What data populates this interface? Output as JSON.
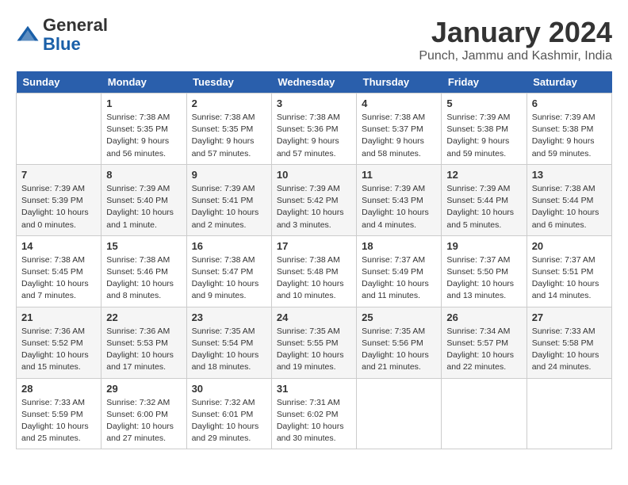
{
  "header": {
    "logo_general": "General",
    "logo_blue": "Blue",
    "month_title": "January 2024",
    "location": "Punch, Jammu and Kashmir, India"
  },
  "weekdays": [
    "Sunday",
    "Monday",
    "Tuesday",
    "Wednesday",
    "Thursday",
    "Friday",
    "Saturday"
  ],
  "weeks": [
    [
      {
        "day": "",
        "sunrise": "",
        "sunset": "",
        "daylight": ""
      },
      {
        "day": "1",
        "sunrise": "Sunrise: 7:38 AM",
        "sunset": "Sunset: 5:35 PM",
        "daylight": "Daylight: 9 hours and 56 minutes."
      },
      {
        "day": "2",
        "sunrise": "Sunrise: 7:38 AM",
        "sunset": "Sunset: 5:35 PM",
        "daylight": "Daylight: 9 hours and 57 minutes."
      },
      {
        "day": "3",
        "sunrise": "Sunrise: 7:38 AM",
        "sunset": "Sunset: 5:36 PM",
        "daylight": "Daylight: 9 hours and 57 minutes."
      },
      {
        "day": "4",
        "sunrise": "Sunrise: 7:38 AM",
        "sunset": "Sunset: 5:37 PM",
        "daylight": "Daylight: 9 hours and 58 minutes."
      },
      {
        "day": "5",
        "sunrise": "Sunrise: 7:39 AM",
        "sunset": "Sunset: 5:38 PM",
        "daylight": "Daylight: 9 hours and 59 minutes."
      },
      {
        "day": "6",
        "sunrise": "Sunrise: 7:39 AM",
        "sunset": "Sunset: 5:38 PM",
        "daylight": "Daylight: 9 hours and 59 minutes."
      }
    ],
    [
      {
        "day": "7",
        "sunrise": "Sunrise: 7:39 AM",
        "sunset": "Sunset: 5:39 PM",
        "daylight": "Daylight: 10 hours and 0 minutes."
      },
      {
        "day": "8",
        "sunrise": "Sunrise: 7:39 AM",
        "sunset": "Sunset: 5:40 PM",
        "daylight": "Daylight: 10 hours and 1 minute."
      },
      {
        "day": "9",
        "sunrise": "Sunrise: 7:39 AM",
        "sunset": "Sunset: 5:41 PM",
        "daylight": "Daylight: 10 hours and 2 minutes."
      },
      {
        "day": "10",
        "sunrise": "Sunrise: 7:39 AM",
        "sunset": "Sunset: 5:42 PM",
        "daylight": "Daylight: 10 hours and 3 minutes."
      },
      {
        "day": "11",
        "sunrise": "Sunrise: 7:39 AM",
        "sunset": "Sunset: 5:43 PM",
        "daylight": "Daylight: 10 hours and 4 minutes."
      },
      {
        "day": "12",
        "sunrise": "Sunrise: 7:39 AM",
        "sunset": "Sunset: 5:44 PM",
        "daylight": "Daylight: 10 hours and 5 minutes."
      },
      {
        "day": "13",
        "sunrise": "Sunrise: 7:38 AM",
        "sunset": "Sunset: 5:44 PM",
        "daylight": "Daylight: 10 hours and 6 minutes."
      }
    ],
    [
      {
        "day": "14",
        "sunrise": "Sunrise: 7:38 AM",
        "sunset": "Sunset: 5:45 PM",
        "daylight": "Daylight: 10 hours and 7 minutes."
      },
      {
        "day": "15",
        "sunrise": "Sunrise: 7:38 AM",
        "sunset": "Sunset: 5:46 PM",
        "daylight": "Daylight: 10 hours and 8 minutes."
      },
      {
        "day": "16",
        "sunrise": "Sunrise: 7:38 AM",
        "sunset": "Sunset: 5:47 PM",
        "daylight": "Daylight: 10 hours and 9 minutes."
      },
      {
        "day": "17",
        "sunrise": "Sunrise: 7:38 AM",
        "sunset": "Sunset: 5:48 PM",
        "daylight": "Daylight: 10 hours and 10 minutes."
      },
      {
        "day": "18",
        "sunrise": "Sunrise: 7:37 AM",
        "sunset": "Sunset: 5:49 PM",
        "daylight": "Daylight: 10 hours and 11 minutes."
      },
      {
        "day": "19",
        "sunrise": "Sunrise: 7:37 AM",
        "sunset": "Sunset: 5:50 PM",
        "daylight": "Daylight: 10 hours and 13 minutes."
      },
      {
        "day": "20",
        "sunrise": "Sunrise: 7:37 AM",
        "sunset": "Sunset: 5:51 PM",
        "daylight": "Daylight: 10 hours and 14 minutes."
      }
    ],
    [
      {
        "day": "21",
        "sunrise": "Sunrise: 7:36 AM",
        "sunset": "Sunset: 5:52 PM",
        "daylight": "Daylight: 10 hours and 15 minutes."
      },
      {
        "day": "22",
        "sunrise": "Sunrise: 7:36 AM",
        "sunset": "Sunset: 5:53 PM",
        "daylight": "Daylight: 10 hours and 17 minutes."
      },
      {
        "day": "23",
        "sunrise": "Sunrise: 7:35 AM",
        "sunset": "Sunset: 5:54 PM",
        "daylight": "Daylight: 10 hours and 18 minutes."
      },
      {
        "day": "24",
        "sunrise": "Sunrise: 7:35 AM",
        "sunset": "Sunset: 5:55 PM",
        "daylight": "Daylight: 10 hours and 19 minutes."
      },
      {
        "day": "25",
        "sunrise": "Sunrise: 7:35 AM",
        "sunset": "Sunset: 5:56 PM",
        "daylight": "Daylight: 10 hours and 21 minutes."
      },
      {
        "day": "26",
        "sunrise": "Sunrise: 7:34 AM",
        "sunset": "Sunset: 5:57 PM",
        "daylight": "Daylight: 10 hours and 22 minutes."
      },
      {
        "day": "27",
        "sunrise": "Sunrise: 7:33 AM",
        "sunset": "Sunset: 5:58 PM",
        "daylight": "Daylight: 10 hours and 24 minutes."
      }
    ],
    [
      {
        "day": "28",
        "sunrise": "Sunrise: 7:33 AM",
        "sunset": "Sunset: 5:59 PM",
        "daylight": "Daylight: 10 hours and 25 minutes."
      },
      {
        "day": "29",
        "sunrise": "Sunrise: 7:32 AM",
        "sunset": "Sunset: 6:00 PM",
        "daylight": "Daylight: 10 hours and 27 minutes."
      },
      {
        "day": "30",
        "sunrise": "Sunrise: 7:32 AM",
        "sunset": "Sunset: 6:01 PM",
        "daylight": "Daylight: 10 hours and 29 minutes."
      },
      {
        "day": "31",
        "sunrise": "Sunrise: 7:31 AM",
        "sunset": "Sunset: 6:02 PM",
        "daylight": "Daylight: 10 hours and 30 minutes."
      },
      {
        "day": "",
        "sunrise": "",
        "sunset": "",
        "daylight": ""
      },
      {
        "day": "",
        "sunrise": "",
        "sunset": "",
        "daylight": ""
      },
      {
        "day": "",
        "sunrise": "",
        "sunset": "",
        "daylight": ""
      }
    ]
  ]
}
